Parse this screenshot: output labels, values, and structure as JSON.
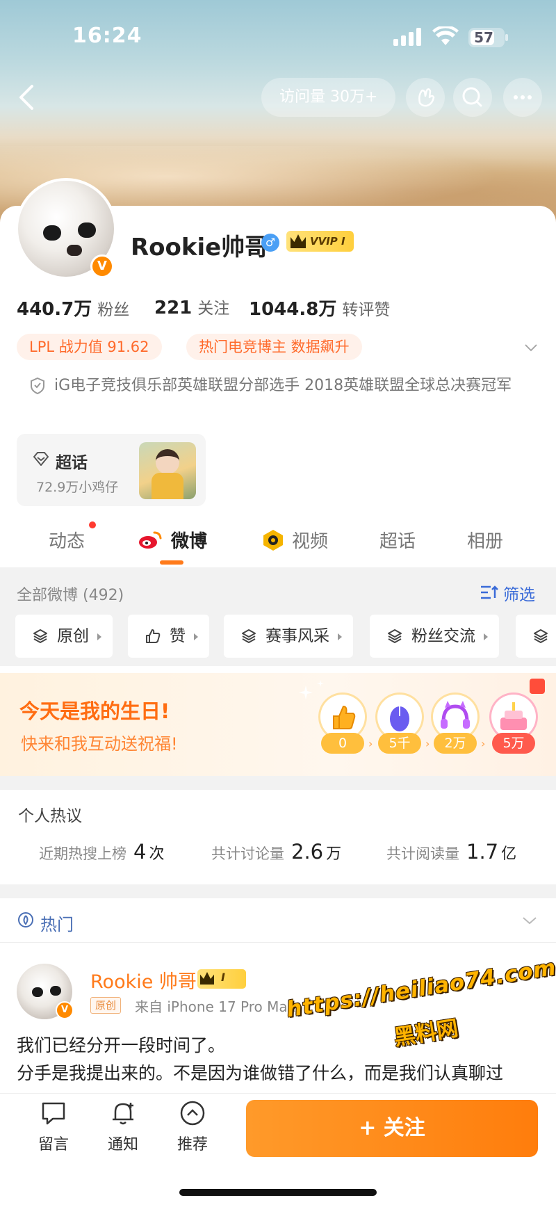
{
  "status_bar": {
    "time": "16:24",
    "battery": "57"
  },
  "header": {
    "visits": "访问量 30万+"
  },
  "profile": {
    "name": "Rookie帅哥",
    "vvip": "VVIP I",
    "verified_badge": "V",
    "stats": [
      {
        "value": "440.7万",
        "label": "粉丝"
      },
      {
        "value": "221",
        "label": "关注"
      },
      {
        "value": "1044.8万",
        "label": "转评赞"
      }
    ],
    "tags": [
      "LPL 战力值  91.62",
      "热门电竞博主 数据飙升"
    ],
    "bio": "iG电子竞技俱乐部英雄联盟分部选手 2018英雄联盟全球总决赛冠军",
    "supertopic": {
      "title": "超话",
      "subtitle": "72.9万小鸡仔"
    }
  },
  "tabs": [
    {
      "label": "动态",
      "active": false
    },
    {
      "label": "微博",
      "active": true
    },
    {
      "label": "视频",
      "active": false
    },
    {
      "label": "超话",
      "active": false
    },
    {
      "label": "相册",
      "active": false
    }
  ],
  "feed": {
    "all_posts": "全部微博 (492)",
    "filter": "筛选",
    "chips": [
      "原创",
      "赞",
      "赛事风采",
      "粉丝交流"
    ]
  },
  "birthday": {
    "title": "今天是我的生日!",
    "subtitle": "快来和我互动送祝福!",
    "tiers": [
      "0",
      "5千",
      "2万",
      "5万"
    ]
  },
  "hot_topics": {
    "title": "个人热议",
    "items": [
      {
        "label": "近期热搜上榜",
        "value": "4",
        "unit": "次"
      },
      {
        "label": "共计讨论量",
        "value": "2.6",
        "unit": "万"
      },
      {
        "label": "共计阅读量",
        "value": "1.7",
        "unit": "亿"
      }
    ]
  },
  "hot_section": {
    "label": "热门"
  },
  "post": {
    "author": "Rookie 帅哥",
    "crown": "I",
    "original": "原创",
    "source": "来自 iPhone 17 Pro Max",
    "line1": "我们已经分开一段时间了。",
    "line2": "分手是我提出来的。不是因为谁做错了什么，而是我们认真聊过"
  },
  "watermark": {
    "url": "https://heiliao74.com",
    "name": "黑料网"
  },
  "bottom_bar": {
    "items": [
      "留言",
      "通知",
      "推荐"
    ],
    "follow": "+ 关注"
  },
  "colors": {
    "accent": "#ff7d0c",
    "link": "#3a6bd8",
    "tag_text": "#ff6a2b"
  }
}
